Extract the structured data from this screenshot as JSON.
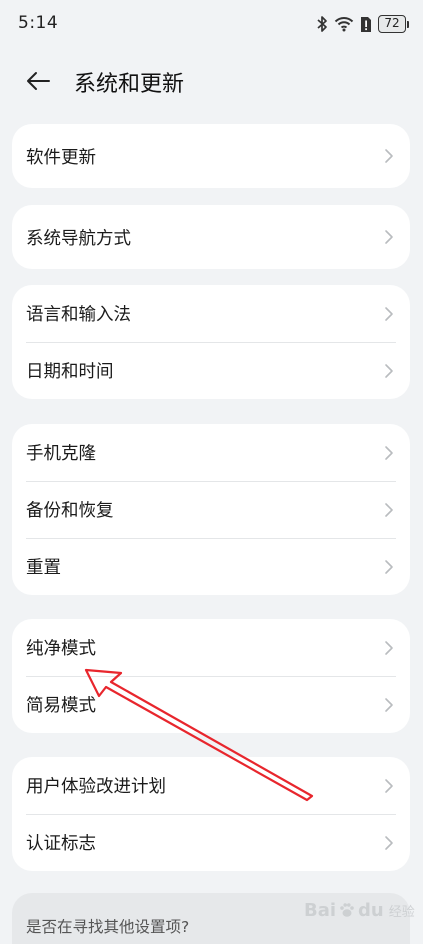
{
  "status": {
    "time": "5:14",
    "battery": "72"
  },
  "header": {
    "title": "系统和更新"
  },
  "groups": [
    {
      "items": [
        {
          "label": "软件更新"
        }
      ]
    },
    {
      "items": [
        {
          "label": "系统导航方式"
        }
      ]
    },
    {
      "items": [
        {
          "label": "语言和输入法"
        },
        {
          "label": "日期和时间"
        }
      ]
    },
    {
      "items": [
        {
          "label": "手机克隆"
        },
        {
          "label": "备份和恢复"
        },
        {
          "label": "重置"
        }
      ]
    },
    {
      "items": [
        {
          "label": "纯净模式"
        },
        {
          "label": "简易模式"
        }
      ]
    },
    {
      "items": [
        {
          "label": "用户体验改进计划"
        },
        {
          "label": "认证标志"
        }
      ]
    }
  ],
  "search_hint": "是否在寻找其他设置项?",
  "watermark": {
    "brand": "Bai",
    "brand_suffix": "du",
    "sub": "经验"
  },
  "annotation": {
    "color": "#e8262d",
    "target": "纯净模式"
  }
}
